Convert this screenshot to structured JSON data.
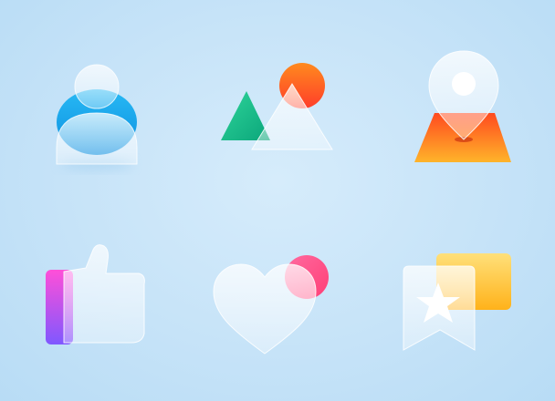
{
  "icons": [
    {
      "name": "user-icon"
    },
    {
      "name": "image-icon"
    },
    {
      "name": "location-pin-icon"
    },
    {
      "name": "thumbs-up-icon"
    },
    {
      "name": "heart-icon"
    },
    {
      "name": "bookmark-star-icon"
    }
  ],
  "colors": {
    "background": "#c6e3f8",
    "user_blue": "#1aa6ec",
    "image_green": "#19c08d",
    "image_sun": "#ff6a1a",
    "pin_orange": "#ff5b24",
    "like_pink": "#ff4fd8",
    "like_purple": "#8a5cff",
    "heart_pink": "#ff4f86",
    "bookmark_yellow": "#ffc21a",
    "glass": "#ffffff"
  }
}
